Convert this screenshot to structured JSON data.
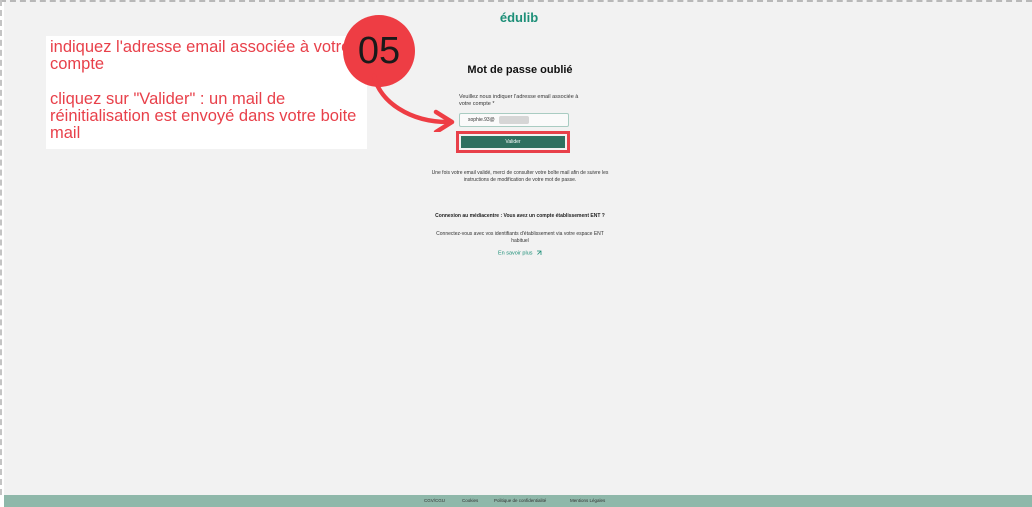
{
  "app": {
    "logo": "édulib"
  },
  "annotation": {
    "step": "05",
    "line1": "indiquez l'adresse email associée à votre compte",
    "line2": "cliquez sur \"Valider\" : un mail de réinitialisation est envoyé dans votre boite mail"
  },
  "form": {
    "title": "Mot de passe oublié",
    "label": "Veuillez nous indiquer l'adresse email associée à votre compte *",
    "email_value": "sophie.93@",
    "submit_label": "Valider"
  },
  "info": {
    "text": "Une fois votre email validé, merci de consulter votre boîte mail afin de suivre les instructions de modification de votre mot de passe."
  },
  "ent": {
    "heading": "Connexion au médiacentre : Vous avez un compte établissement ENT ?",
    "text": "Connectez-vous avec vos identifiants d'établissement via votre espace ENT habituel",
    "link": "En savoir plus",
    "link_icon": "external-link-icon"
  },
  "footer": {
    "links": [
      "CGV/CGU",
      "Cookies",
      "Politique de confidentialité",
      "Mentions Légales"
    ]
  },
  "colors": {
    "brand": "#1d8f78",
    "annotation": "#e8404a",
    "button": "#2f7060",
    "footer": "#8fb8aa"
  }
}
